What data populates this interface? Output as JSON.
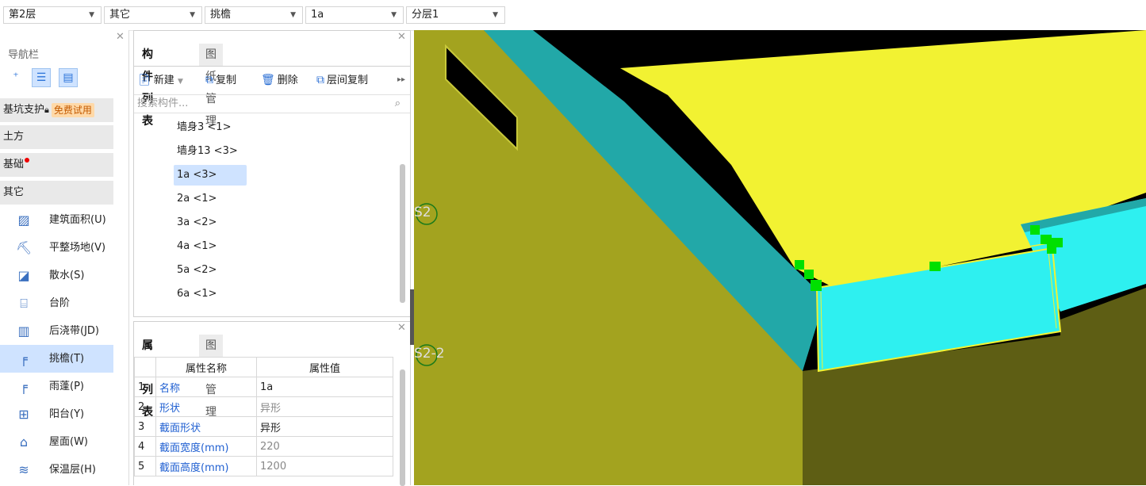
{
  "toolbar": {
    "floor": "第2层",
    "category": "其它",
    "component_type": "挑檐",
    "component": "1a",
    "layer": "分层1"
  },
  "nav": {
    "title": "导航栏",
    "sections": {
      "pit": "基坑支护",
      "pit_badge": "免费试用",
      "earthwork": "土方",
      "foundation": "基础",
      "other": "其它"
    },
    "items": [
      {
        "label": "建筑面积(U)",
        "icon": "building-area-icon"
      },
      {
        "label": "平整场地(V)",
        "icon": "site-leveling-icon"
      },
      {
        "label": "散水(S)",
        "icon": "apron-icon"
      },
      {
        "label": "台阶",
        "icon": "steps-icon"
      },
      {
        "label": "后浇带(JD)",
        "icon": "post-cast-strip-icon"
      },
      {
        "label": "挑檐(T)",
        "icon": "eave-icon"
      },
      {
        "label": "雨蓬(P)",
        "icon": "canopy-icon"
      },
      {
        "label": "阳台(Y)",
        "icon": "balcony-icon"
      },
      {
        "label": "屋面(W)",
        "icon": "roof-icon"
      },
      {
        "label": "保温层(H)",
        "icon": "insulation-icon"
      }
    ]
  },
  "component_panel": {
    "tabs": [
      "构件列表",
      "图纸管理"
    ],
    "actions": {
      "new": "新建",
      "copy": "复制",
      "delete": "删除",
      "floor_copy": "层间复制"
    },
    "search_placeholder": "搜索构件...",
    "items": [
      "墙身3 <1>",
      "墙身13 <3>",
      "1a <3>",
      "2a <1>",
      "3a <2>",
      "4a <1>",
      "5a <2>",
      "6a <1>"
    ],
    "selected_index": 2
  },
  "property_panel": {
    "tabs": [
      "属性列表",
      "图层管理"
    ],
    "headers": {
      "name": "属性名称",
      "value": "属性值"
    },
    "rows": [
      {
        "no": "1",
        "name": "名称",
        "value": "1a",
        "muted": false
      },
      {
        "no": "2",
        "name": "形状",
        "value": "异形",
        "muted": true
      },
      {
        "no": "3",
        "name": "截面形状",
        "value": "异形",
        "muted": false
      },
      {
        "no": "4",
        "name": "截面宽度(mm)",
        "value": "220",
        "muted": true
      },
      {
        "no": "5",
        "name": "截面高度(mm)",
        "value": "1200",
        "muted": true
      }
    ]
  },
  "viewport": {
    "labels": [
      "S2",
      "S2-2"
    ]
  },
  "colors": {
    "selection": "#cfe3ff",
    "accent_blue": "#2b6fd4",
    "roof_yellow": "#f2f232",
    "wall_olive": "#a3a31f",
    "cyan_face": "#2ef0f0",
    "teal_face": "#22a8a8",
    "grip_green": "#00e000"
  }
}
